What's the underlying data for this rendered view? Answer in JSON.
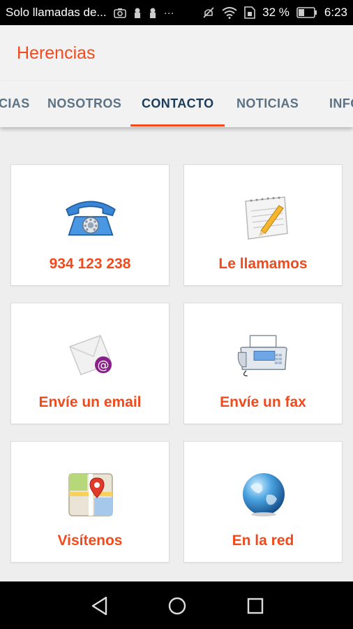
{
  "status_bar": {
    "carrier_text": "Solo llamadas de...",
    "battery_percent": "32 %",
    "time": "6:23",
    "icons": [
      "camera-icon",
      "lock-icon",
      "lock-icon",
      "more-icon",
      "mute-icon",
      "wifi-icon",
      "sim-icon",
      "battery-icon"
    ]
  },
  "app_bar": {
    "title": "Herencias"
  },
  "tabs": [
    {
      "label": "CIAS"
    },
    {
      "label": "NOSOTROS"
    },
    {
      "label": "CONTACTO",
      "active": true
    },
    {
      "label": "NOTICIAS"
    },
    {
      "label": "INFO"
    }
  ],
  "cards": [
    {
      "label": "934 123 238",
      "icon": "telephone-icon"
    },
    {
      "label": "Le llamamos",
      "icon": "notepad-pencil-icon"
    },
    {
      "label": "Envíe un email",
      "icon": "email-envelope-icon"
    },
    {
      "label": "Envíe un fax",
      "icon": "fax-machine-icon"
    },
    {
      "label": "Visítenos",
      "icon": "map-pin-icon"
    },
    {
      "label": "En la red",
      "icon": "globe-icon"
    }
  ],
  "colors": {
    "accent": "#f04a1d",
    "tab_active": "#1c3d5a",
    "tab_inactive": "#5b7184"
  },
  "nav_bar": {
    "buttons": [
      "back-icon",
      "home-icon",
      "recents-icon"
    ]
  }
}
